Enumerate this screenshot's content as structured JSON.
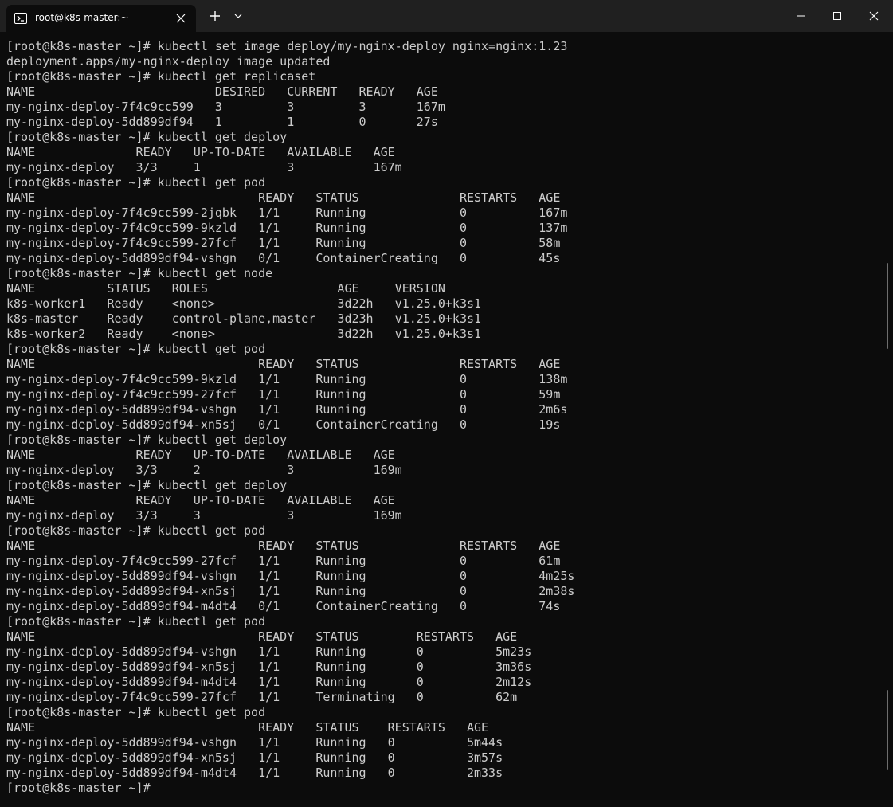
{
  "window": {
    "tab_title": "root@k8s-master:~",
    "tab_icon": "powershell-icon",
    "colors": {
      "titlebar": "#202020",
      "terminal_bg": "#0c0c0c",
      "text": "#cccccc"
    }
  },
  "terminal": {
    "lines": [
      "[root@k8s-master ~]# kubectl set image deploy/my-nginx-deploy nginx=nginx:1.23",
      "deployment.apps/my-nginx-deploy image updated",
      "[root@k8s-master ~]# kubectl get replicaset",
      "NAME                         DESIRED   CURRENT   READY   AGE",
      "my-nginx-deploy-7f4c9cc599   3         3         3       167m",
      "my-nginx-deploy-5dd899df94   1         1         0       27s",
      "[root@k8s-master ~]# kubectl get deploy",
      "NAME              READY   UP-TO-DATE   AVAILABLE   AGE",
      "my-nginx-deploy   3/3     1            3           167m",
      "[root@k8s-master ~]# kubectl get pod",
      "NAME                               READY   STATUS              RESTARTS   AGE",
      "my-nginx-deploy-7f4c9cc599-2jqbk   1/1     Running             0          167m",
      "my-nginx-deploy-7f4c9cc599-9kzld   1/1     Running             0          137m",
      "my-nginx-deploy-7f4c9cc599-27fcf   1/1     Running             0          58m",
      "my-nginx-deploy-5dd899df94-vshgn   0/1     ContainerCreating   0          45s",
      "[root@k8s-master ~]# kubectl get node",
      "NAME          STATUS   ROLES                  AGE     VERSION",
      "k8s-worker1   Ready    <none>                 3d22h   v1.25.0+k3s1",
      "k8s-master    Ready    control-plane,master   3d23h   v1.25.0+k3s1",
      "k8s-worker2   Ready    <none>                 3d22h   v1.25.0+k3s1",
      "[root@k8s-master ~]# kubectl get pod",
      "NAME                               READY   STATUS              RESTARTS   AGE",
      "my-nginx-deploy-7f4c9cc599-9kzld   1/1     Running             0          138m",
      "my-nginx-deploy-7f4c9cc599-27fcf   1/1     Running             0          59m",
      "my-nginx-deploy-5dd899df94-vshgn   1/1     Running             0          2m6s",
      "my-nginx-deploy-5dd899df94-xn5sj   0/1     ContainerCreating   0          19s",
      "[root@k8s-master ~]# kubectl get deploy",
      "NAME              READY   UP-TO-DATE   AVAILABLE   AGE",
      "my-nginx-deploy   3/3     2            3           169m",
      "[root@k8s-master ~]# kubectl get deploy",
      "NAME              READY   UP-TO-DATE   AVAILABLE   AGE",
      "my-nginx-deploy   3/3     3            3           169m",
      "[root@k8s-master ~]# kubectl get pod",
      "NAME                               READY   STATUS              RESTARTS   AGE",
      "my-nginx-deploy-7f4c9cc599-27fcf   1/1     Running             0          61m",
      "my-nginx-deploy-5dd899df94-vshgn   1/1     Running             0          4m25s",
      "my-nginx-deploy-5dd899df94-xn5sj   1/1     Running             0          2m38s",
      "my-nginx-deploy-5dd899df94-m4dt4   0/1     ContainerCreating   0          74s",
      "[root@k8s-master ~]# kubectl get pod",
      "NAME                               READY   STATUS        RESTARTS   AGE",
      "my-nginx-deploy-5dd899df94-vshgn   1/1     Running       0          5m23s",
      "my-nginx-deploy-5dd899df94-xn5sj   1/1     Running       0          3m36s",
      "my-nginx-deploy-5dd899df94-m4dt4   1/1     Running       0          2m12s",
      "my-nginx-deploy-7f4c9cc599-27fcf   1/1     Terminating   0          62m",
      "[root@k8s-master ~]# kubectl get pod",
      "NAME                               READY   STATUS    RESTARTS   AGE",
      "my-nginx-deploy-5dd899df94-vshgn   1/1     Running   0          5m44s",
      "my-nginx-deploy-5dd899df94-xn5sj   1/1     Running   0          3m57s",
      "my-nginx-deploy-5dd899df94-m4dt4   1/1     Running   0          2m33s",
      "[root@k8s-master ~]#"
    ]
  }
}
